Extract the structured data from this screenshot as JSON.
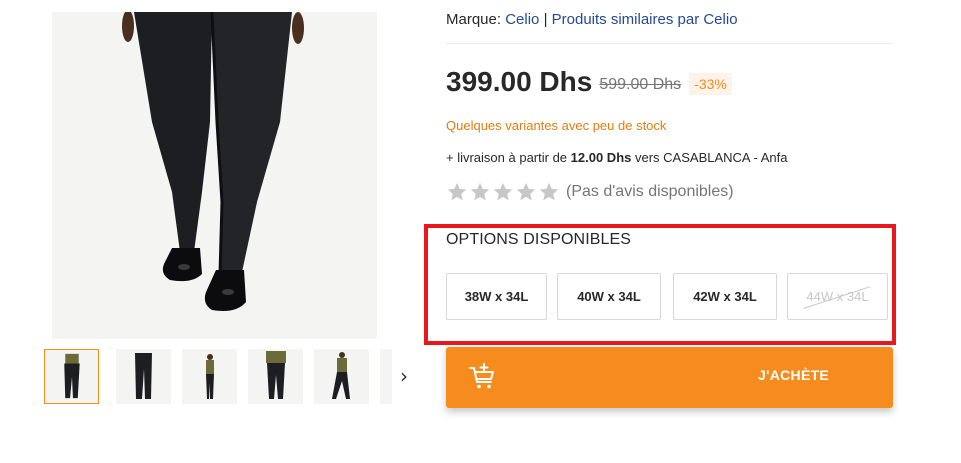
{
  "product": {
    "brand_label": "Marque:",
    "brand_name": "Celio",
    "brand_separator": "|",
    "similar_link": "Produits similaires par Celio"
  },
  "pricing": {
    "current_price": "399.00 Dhs",
    "old_price": "599.00 Dhs",
    "discount": "-33%"
  },
  "stock_note": "Quelques variantes avec peu de stock",
  "delivery": {
    "prefix": "+ livraison à partir de",
    "amount": "12.00 Dhs",
    "middle": "vers",
    "location": "CASABLANCA - Anfa"
  },
  "rating": {
    "stars_filled": 0,
    "stars_total": 5,
    "label": "(Pas d'avis disponibles)"
  },
  "options": {
    "title": "OPTIONS DISPONIBLES",
    "items": [
      {
        "label": "38W x 34L",
        "available": true
      },
      {
        "label": "40W x 34L",
        "available": true
      },
      {
        "label": "42W x 34L",
        "available": true
      },
      {
        "label": "44W x 34L",
        "available": false
      }
    ]
  },
  "buy_button": {
    "label": "J'ACHÈTE",
    "icon": "add-to-cart-icon"
  },
  "gallery": {
    "thumbnails": [
      "thumbnail-1",
      "thumbnail-2",
      "thumbnail-3",
      "thumbnail-4",
      "thumbnail-5",
      "thumbnail-6"
    ],
    "active_index": 0,
    "next_icon": "chevron-right-icon",
    "next_label": "›"
  },
  "colors": {
    "accent": "#f68b1e",
    "link": "#264996",
    "highlight_border": "#e8181e",
    "stock_warning": "#e07e10",
    "star_empty": "#c7c7c7"
  }
}
